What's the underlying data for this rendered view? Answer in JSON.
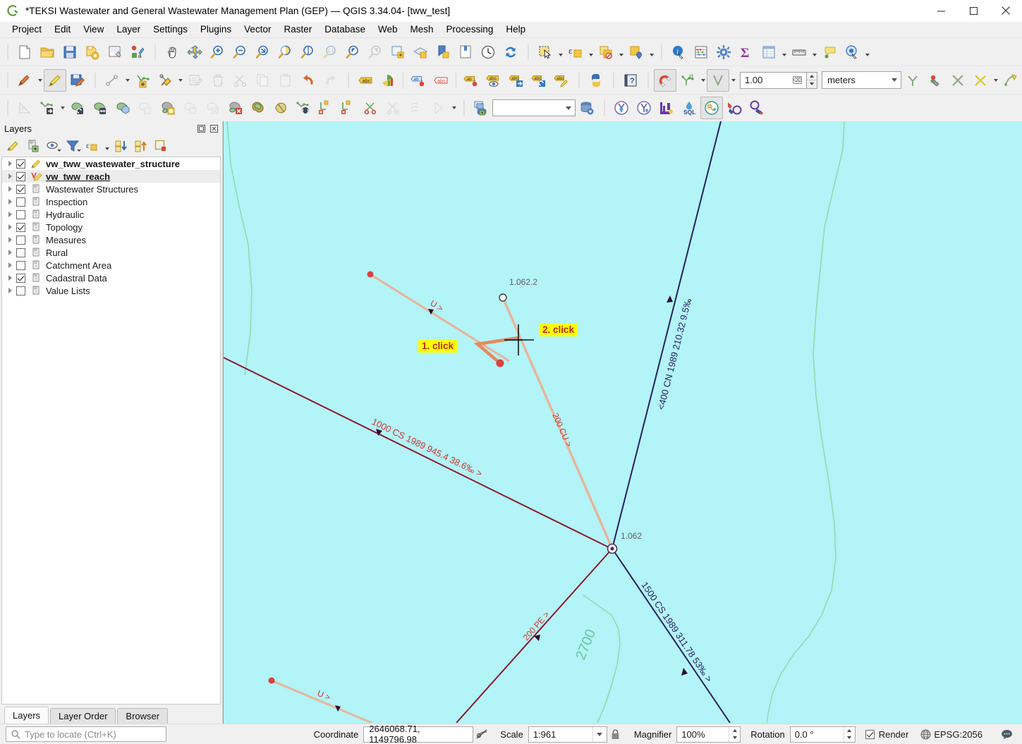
{
  "window": {
    "title": "*TEKSI Wastewater and General Wastewater Management Plan (GEP) — QGIS 3.34.04- [tww_test]",
    "logo_icon": "qgis-logo-icon",
    "minimize_icon": "minimize-icon",
    "maximize_icon": "maximize-icon",
    "close_icon": "close-icon"
  },
  "menubar": {
    "items": [
      {
        "label": "Project"
      },
      {
        "label": "Edit"
      },
      {
        "label": "View"
      },
      {
        "label": "Layer"
      },
      {
        "label": "Settings"
      },
      {
        "label": "Plugins"
      },
      {
        "label": "Vector"
      },
      {
        "label": "Raster"
      },
      {
        "label": "Database"
      },
      {
        "label": "Web"
      },
      {
        "label": "Mesh"
      },
      {
        "label": "Processing"
      },
      {
        "label": "Help"
      }
    ]
  },
  "toolbar_row1": {
    "icons": [
      "new-project-icon",
      "open-project-icon",
      "save-project-icon",
      "save-project-as-icon",
      "new-print-layout-icon",
      "style-manager-icon",
      "pan-map-icon",
      "pan-to-selection-icon",
      "zoom-in-icon",
      "zoom-out-icon",
      "zoom-full-icon",
      "zoom-to-selection-icon",
      "zoom-to-layer-icon",
      "zoom-native-icon",
      "zoom-last-icon",
      "zoom-next-icon",
      "new-map-view-icon",
      "new-3d-map-view-icon",
      "new-spatial-bookmark-icon",
      "show-bookmarks-icon",
      "temporal-controller-icon",
      "refresh-icon",
      "select-features-icon",
      "select-by-expression-icon",
      "deselect-features-icon",
      "identify-results-icon",
      "identify-features-icon",
      "measure-abacus-icon",
      "options-gear-icon",
      "statistical-summary-icon",
      "open-attribute-table-icon",
      "measure-line-icon",
      "map-tips-icon",
      "show-unplaced-labels-icon"
    ]
  },
  "toolbar_row2": {
    "icons": [
      "current-edits-icon",
      "toggle-editing-icon",
      "save-layer-edits-icon",
      "add-feature-icon",
      "vertex-tool-icon",
      "digitize-with-shape-icon",
      "modify-attributes-icon",
      "delete-selected-icon",
      "cut-features-icon",
      "copy-features-icon",
      "paste-features-icon",
      "undo-icon",
      "redo-icon",
      "label-icon",
      "diagram-icon",
      "pin-labels-icon",
      "show-hide-labels-icon",
      "move-label-icon",
      "show-pinned-labels-icon",
      "move-label-2-icon",
      "rotate-label-icon",
      "change-label-icon",
      "python-console-icon",
      "help-contents-icon",
      "enable-snapping-icon",
      "snapping-options-icon",
      "snapping-mode-icon",
      "avoid-overlap-icon",
      "self-snapping-icon",
      "topological-editing-icon",
      "intersection-snapping-icon",
      "tracing-icon",
      "trace-options-icon"
    ],
    "tolerance_value": "1.00",
    "tolerance_units": "meters",
    "clear_icon": "clear-field-icon"
  },
  "toolbar_row3": {
    "icons": [
      "measure-angle-icon",
      "move-feature-icon",
      "rotate-feature-icon",
      "simplify-feature-icon",
      "add-ring-icon",
      "add-part-icon",
      "fill-ring-icon",
      "delete-ring-icon",
      "delete-part-icon",
      "reshape-features-icon",
      "offset-curve-icon",
      "split-features-icon",
      "split-parts-icon",
      "merge-features-icon",
      "merge-attributes-icon",
      "rotate-point-symbols-icon",
      "offset-point-symbol-icon",
      "new-shapefile-layer-icon",
      "db-manager-icon",
      "postgis-icon",
      "tww-wizard-icon",
      "tww-wizard2-icon",
      "tww-profile-icon",
      "tww-sql-icon",
      "tww-connect-icon",
      "tww-zero-1-icon",
      "tww-zero-2-icon"
    ],
    "dropdown_value": ""
  },
  "layers_panel": {
    "title": "Layers",
    "undock_icon": "undock-panel-icon",
    "close_icon": "close-panel-icon",
    "toolbar_icons": [
      "open-layer-styling-panel-icon",
      "add-group-icon",
      "manage-map-themes-icon",
      "filter-legend-icon",
      "filter-legend-by-expression-icon",
      "expand-all-icon",
      "collapse-all-icon",
      "remove-layer-icon"
    ],
    "items": [
      {
        "label": "vw_tww_wastewater_structure",
        "checked": true,
        "style": "bold",
        "icon": "edit-point-layer-icon"
      },
      {
        "label": "vw_tww_reach",
        "checked": true,
        "style": "boldul",
        "icon": "edit-line-layer-icon",
        "selected": true
      },
      {
        "label": "Wastewater Structures",
        "checked": true,
        "style": "normal",
        "icon": "group-icon"
      },
      {
        "label": "Inspection",
        "checked": false,
        "style": "normal",
        "icon": "group-icon"
      },
      {
        "label": "Hydraulic",
        "checked": false,
        "style": "normal",
        "icon": "group-icon"
      },
      {
        "label": "Topology",
        "checked": true,
        "style": "normal",
        "icon": "group-icon"
      },
      {
        "label": "Measures",
        "checked": false,
        "style": "normal",
        "icon": "group-icon"
      },
      {
        "label": "Rural",
        "checked": false,
        "style": "normal",
        "icon": "group-icon"
      },
      {
        "label": "Catchment Area",
        "checked": false,
        "style": "normal",
        "icon": "group-icon"
      },
      {
        "label": "Cadastral Data",
        "checked": true,
        "style": "normal",
        "icon": "group-icon"
      },
      {
        "label": "Value Lists",
        "checked": false,
        "style": "normal",
        "icon": "group-icon"
      }
    ],
    "tabs": [
      {
        "label": "Layers",
        "active": true
      },
      {
        "label": "Layer Order",
        "active": false
      },
      {
        "label": "Browser",
        "active": false
      }
    ]
  },
  "map": {
    "background_color": "#b2f4f7",
    "annotations": [
      {
        "text": "1. click",
        "name": "click-1-callout"
      },
      {
        "text": "2. click",
        "name": "click-2-callout"
      }
    ],
    "node_labels": [
      {
        "text": "1.062.2",
        "name": "node-label-1-062-2"
      },
      {
        "text": "1.062",
        "name": "node-label-1-062"
      }
    ],
    "reach_labels": [
      {
        "text": "U >",
        "name": "reach-label-u-upper"
      },
      {
        "text": "200 CU >",
        "name": "reach-label-200-cu"
      },
      {
        "text": "1000 CS 1989 945.4 38.6‰ >",
        "name": "reach-label-1000-cs"
      },
      {
        "text": "<400 CN 1989 210.32 9.5‰",
        "name": "reach-label-400-cn"
      },
      {
        "text": "1500 CS 1989 311.78 53‰ >",
        "name": "reach-label-1500-cs"
      },
      {
        "text": "200 PE >",
        "name": "reach-label-200-pe"
      },
      {
        "text": "U >",
        "name": "reach-label-u-lower"
      },
      {
        "text": "2700",
        "name": "cadastral-label-2700"
      }
    ],
    "colors": {
      "new_reach": "#e8875a",
      "existing_reach_light": "#e8b49a",
      "dark_red_reach": "#8b1a2b",
      "navy_reach": "#2a2060",
      "cadastral_green": "#8fdcb0",
      "node_red": "#d9403f",
      "label_red": "#d4352f",
      "label_navy": "#2a2060",
      "highlight_yellow": "#ffff00"
    }
  },
  "statusbar": {
    "locator_placeholder": "Type to locate (Ctrl+K)",
    "search_icon": "search-icon",
    "coordinate_label": "Coordinate",
    "coordinate_value": "2646068.71, 1149796.98",
    "extents_toggle_icon": "toggle-extents-icon",
    "scale_label": "Scale",
    "scale_value": "1:961",
    "lock_icon": "lock-scale-icon",
    "magnifier_label": "Magnifier",
    "magnifier_value": "100%",
    "rotation_label": "Rotation",
    "rotation_value": "0.0 °",
    "render_label": "Render",
    "render_checked": true,
    "crs_label": "EPSG:2056",
    "crs_icon": "crs-globe-icon",
    "messages_icon": "messages-icon"
  }
}
